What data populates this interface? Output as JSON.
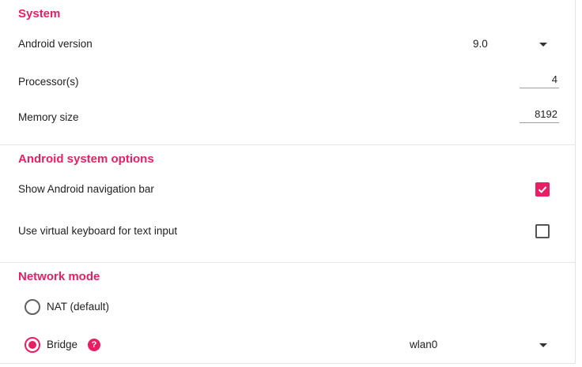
{
  "system": {
    "title": "System",
    "android_version": {
      "label": "Android version",
      "value": "9.0"
    },
    "processors": {
      "label": "Processor(s)",
      "value": "4"
    },
    "memory": {
      "label": "Memory size",
      "value": "8192"
    }
  },
  "android_options": {
    "title": "Android system options",
    "nav_bar": {
      "label": "Show Android navigation bar",
      "checked": true
    },
    "virtual_keyboard": {
      "label": "Use virtual keyboard for text input",
      "checked": false
    }
  },
  "network": {
    "title": "Network mode",
    "nat": {
      "label": "NAT (default)",
      "selected": false
    },
    "bridge": {
      "label": "Bridge",
      "selected": true,
      "help_glyph": "?",
      "interface_value": "wlan0"
    }
  },
  "colors": {
    "accent": "#e91e63",
    "text": "#212121",
    "divider": "#e6e6e6"
  }
}
